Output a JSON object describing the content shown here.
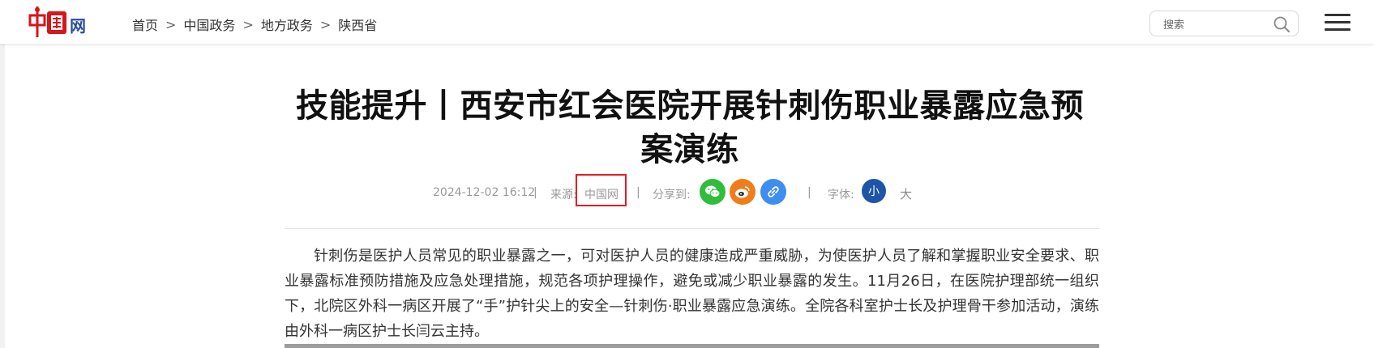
{
  "header": {
    "logo_alt": "中国网",
    "breadcrumb": [
      "首页",
      "中国政务",
      "地方政务",
      "陕西省"
    ],
    "breadcrumb_sep": ">",
    "search_placeholder": "搜索"
  },
  "article": {
    "title": "技能提升丨西安市红会医院开展针刺伤职业暴露应急预案演练",
    "date": "2024-12-02 16:12",
    "source_label": "来源:",
    "source": "中国网",
    "share_label": "分享到:",
    "font_label": "字体:",
    "font_small": "小",
    "font_large": "大",
    "meta_sep": "|",
    "body": "针刺伤是医护人员常见的职业暴露之一，可对医护人员的健康造成严重威胁，为使医护人员了解和掌握职业安全要求、职业暴露标准预防措施及应急处理措施，规范各项护理操作，避免或减少职业暴露的发生。11月26日，在医院护理部统一组织下，北院区外科一病区开展了“手”护针尖上的安全—针刺伤·职业暴露应急演练。全院各科室护士长及护理骨干参加活动，演练由外科一病区护士长闫云主持。"
  },
  "colors": {
    "wechat": "#2fbd3a",
    "weibo": "#f07d1a",
    "link": "#3d8ef0",
    "font_small_bg": "#1f55a8",
    "highlight": "#e81c24",
    "logo_red": "#d7151b",
    "logo_blue": "#2b4c9b"
  },
  "icons": [
    "wechat-icon",
    "weibo-icon",
    "link-icon",
    "search-icon",
    "hamburger-menu-icon"
  ]
}
